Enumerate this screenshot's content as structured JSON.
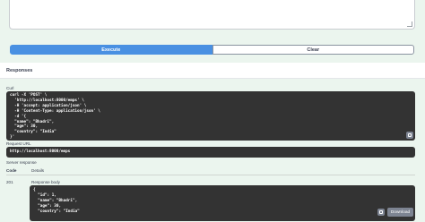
{
  "actions": {
    "execute_label": "Execute",
    "clear_label": "Clear"
  },
  "responses": {
    "title": "Responses"
  },
  "curl": {
    "label": "Curl",
    "lines": [
      "curl -X 'POST' \\",
      "  'http://localhost:8000/emps' \\",
      "  -H 'accept: application/json' \\",
      "  -H 'Content-Type: application/json' \\",
      "  -d '{",
      "  \"name\": \"Bhadri\",",
      "  \"age\": 30,",
      "  \"country\": \"India\"",
      "}'"
    ]
  },
  "request_url": {
    "label": "Request URL",
    "value": "http://localhost:8000/emps"
  },
  "server_response": {
    "label": "Server response",
    "col_code": "Code",
    "col_details": "Details",
    "status_code": "201",
    "body_label": "Response body",
    "body_lines": [
      "{",
      "  \"id\": 1,",
      "  \"name\": \"Bhadri\",",
      "  \"age\": 30,",
      "  \"country\": \"India\""
    ],
    "download_label": "Download"
  },
  "icons": {
    "copy": "copy-icon",
    "resize": "resize-grip-icon"
  }
}
